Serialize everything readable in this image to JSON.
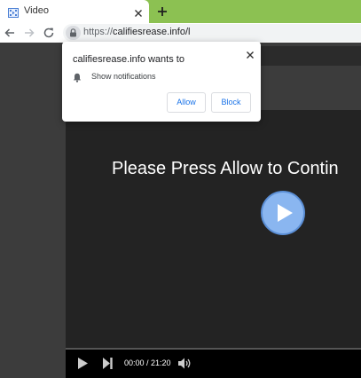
{
  "tab": {
    "title": "Video"
  },
  "omnibox": {
    "scheme": "https://",
    "host": "califiesrease.info/",
    "suffix": "l"
  },
  "popup": {
    "title": "califiesrease.info wants to",
    "permission": "Show notifications",
    "allow_label": "Allow",
    "block_label": "Block"
  },
  "video": {
    "caption": "Please Press Allow to Contin",
    "time": "00:00 / 21:20",
    "progress": 0.0
  },
  "colors": {
    "tabstrip": "#8cc152",
    "accent_blue": "#1a73e8",
    "play_button": "#8ab6f0",
    "progress_red": "#d0021b"
  },
  "icons": [
    "video-favicon-icon",
    "close-icon",
    "plus-icon",
    "back-arrow-icon",
    "forward-arrow-icon",
    "reload-icon",
    "lock-icon",
    "bell-icon",
    "play-icon",
    "skip-next-icon",
    "volume-icon"
  ]
}
